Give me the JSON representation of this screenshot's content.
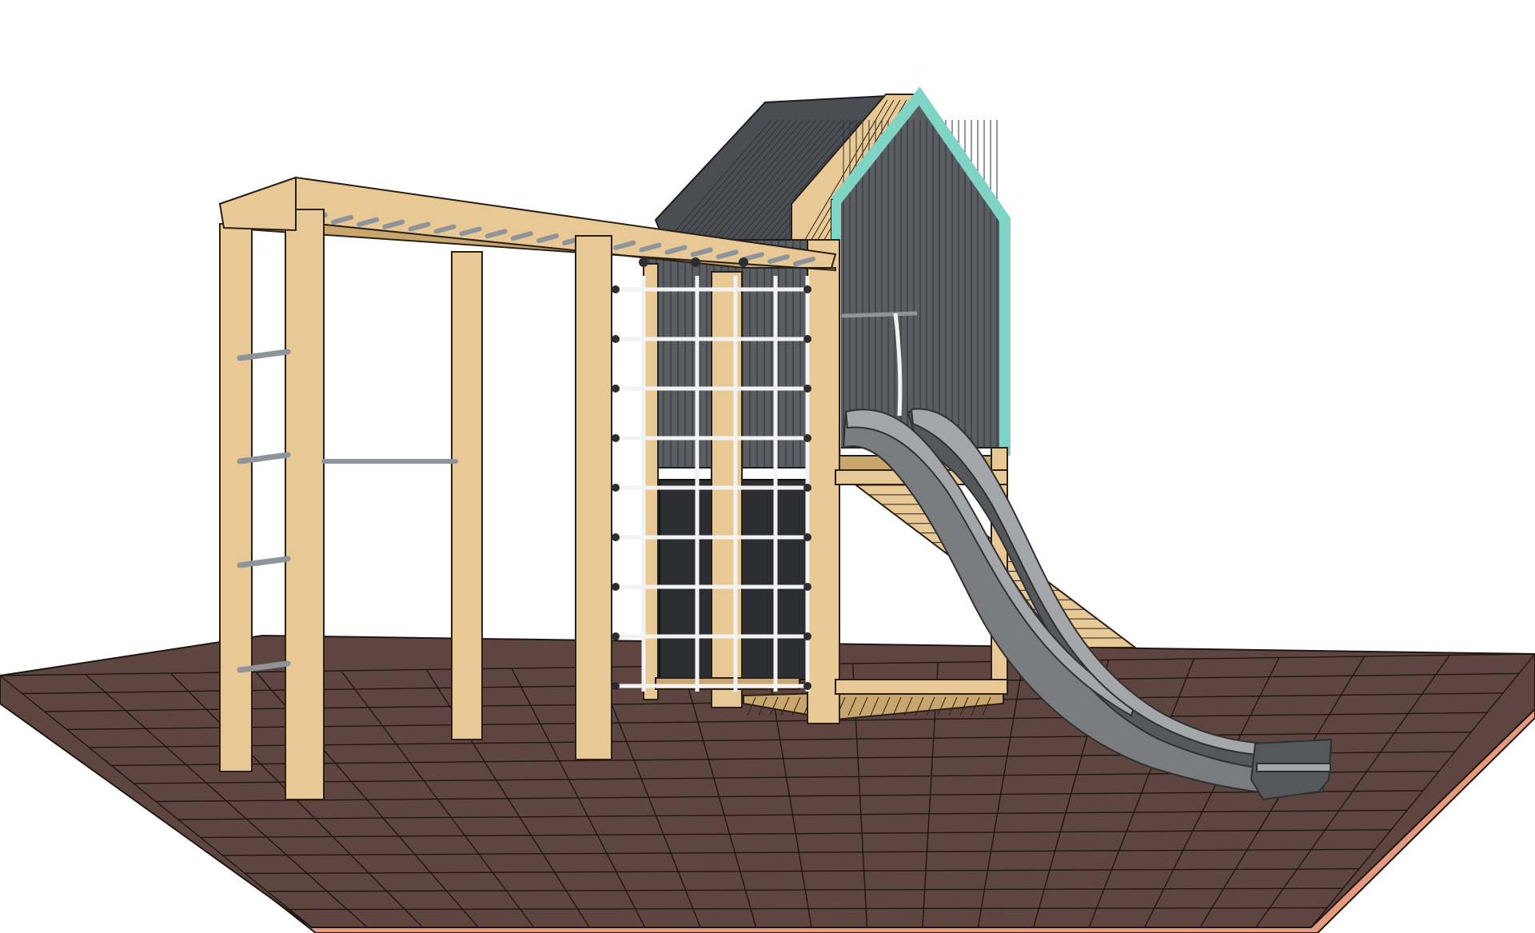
{
  "scene": {
    "subject": "playground",
    "colors": {
      "background": "#ffffff",
      "floor": "#5f4540",
      "floor_grid": "#1f1614",
      "floor_edge": "#e59a7f",
      "wood": "#e8c995",
      "wood_dark": "#c9a66e",
      "wood_outline": "#2a2016",
      "cladding": "#5a5d62",
      "cladding_dark": "#3c3f44",
      "roof": "#4a4d52",
      "trim": "#7fd4c6",
      "slide": "#7a7c7f",
      "slide_dark": "#55575a",
      "slide_light": "#a4a6a9",
      "rope": "#f2f2f2",
      "bar": "#8e949a",
      "panel": "#2b2d30"
    }
  }
}
